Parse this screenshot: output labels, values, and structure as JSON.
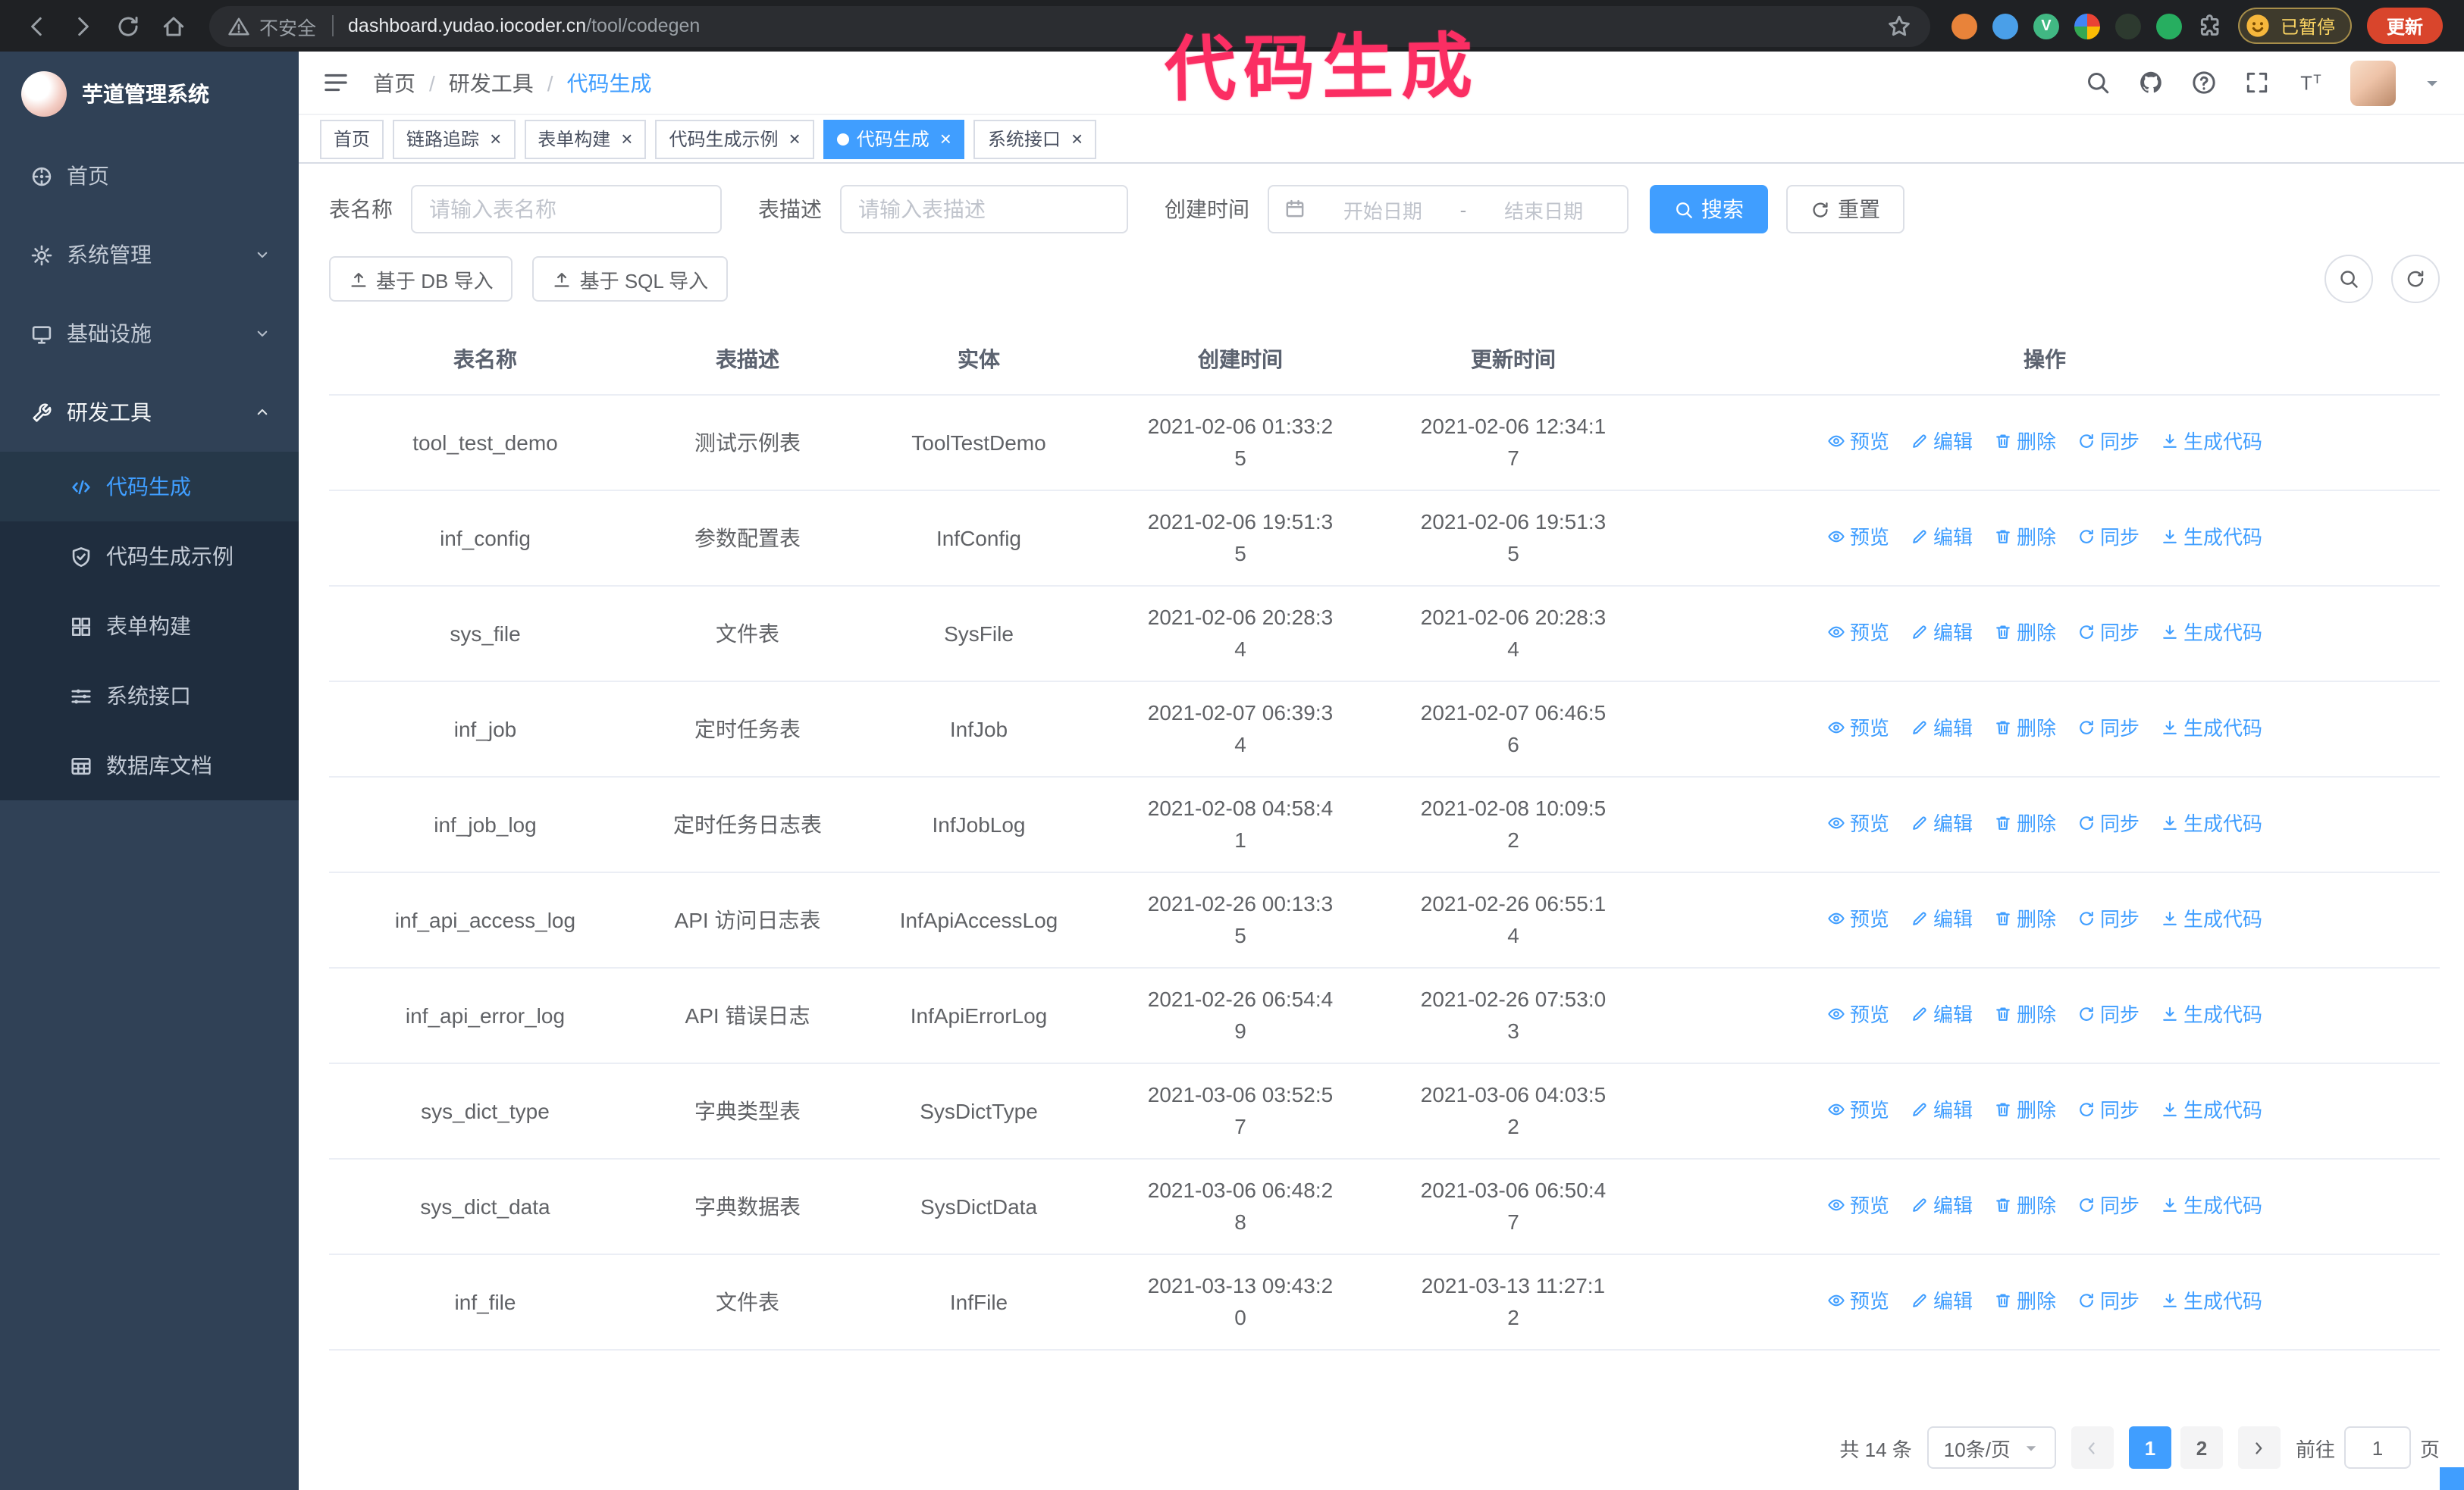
{
  "browser": {
    "security_label": "不安全",
    "url_host": "dashboard.yudao.iocoder.cn",
    "url_path": "/tool/codegen",
    "paused_badge": "已暂停",
    "update_button": "更新",
    "extensions": [
      {
        "color": "#e8833a",
        "label": ""
      },
      {
        "color": "#4a9fe8",
        "label": ""
      },
      {
        "color": "#41b883",
        "label": "V"
      },
      {
        "style": "multi",
        "label": ""
      },
      {
        "color": "#2d3a2f",
        "label": ""
      },
      {
        "color": "#27ae60",
        "label": ""
      },
      {
        "style": "puzzle",
        "label": ""
      }
    ]
  },
  "annotation": {
    "text": "代码生成",
    "color": "#fb2e63"
  },
  "sidebar": {
    "logo_title": "芋道管理系统",
    "items": [
      {
        "id": "home",
        "label": "首页",
        "icon": "dashboard-icon",
        "type": "root"
      },
      {
        "id": "system",
        "label": "系统管理",
        "icon": "gear-icon",
        "type": "root",
        "expandable": true,
        "expanded": false
      },
      {
        "id": "infra",
        "label": "基础设施",
        "icon": "infra-icon",
        "type": "root",
        "expandable": true,
        "expanded": false
      },
      {
        "id": "devtools",
        "label": "研发工具",
        "icon": "tools-icon",
        "type": "root",
        "expandable": true,
        "expanded": true
      },
      {
        "id": "codegen",
        "label": "代码生成",
        "icon": "code-icon",
        "type": "sub",
        "active": true
      },
      {
        "id": "codegen-example",
        "label": "代码生成示例",
        "icon": "shield-check-icon",
        "type": "sub"
      },
      {
        "id": "form-build",
        "label": "表单构建",
        "icon": "form-grid-icon",
        "type": "sub"
      },
      {
        "id": "system-api",
        "label": "系统接口",
        "icon": "sliders-icon",
        "type": "sub"
      },
      {
        "id": "db-doc",
        "label": "数据库文档",
        "icon": "table-doc-icon",
        "type": "sub"
      }
    ]
  },
  "navbar": {
    "breadcrumb": [
      "首页",
      "研发工具",
      "代码生成"
    ],
    "icons": [
      "search-icon",
      "github-icon",
      "help-icon",
      "fullscreen-icon",
      "font-size-icon"
    ]
  },
  "tabs": [
    {
      "id": "home",
      "label": "首页",
      "closable": false,
      "active": false
    },
    {
      "id": "tracer",
      "label": "链路追踪",
      "closable": true,
      "active": false
    },
    {
      "id": "form-build",
      "label": "表单构建",
      "closable": true,
      "active": false
    },
    {
      "id": "codegen-example",
      "label": "代码生成示例",
      "closable": true,
      "active": false
    },
    {
      "id": "codegen",
      "label": "代码生成",
      "closable": true,
      "active": true
    },
    {
      "id": "system-api",
      "label": "系统接口",
      "closable": true,
      "active": false
    }
  ],
  "filters": {
    "table_name_label": "表名称",
    "table_name_placeholder": "请输入表名称",
    "table_desc_label": "表描述",
    "table_desc_placeholder": "请输入表描述",
    "create_time_label": "创建时间",
    "date_start_placeholder": "开始日期",
    "date_separator": "-",
    "date_end_placeholder": "结束日期",
    "search_button": "搜索",
    "reset_button": "重置"
  },
  "toolbar": {
    "import_db_button": "基于 DB 导入",
    "import_sql_button": "基于 SQL 导入"
  },
  "table": {
    "columns": [
      "表名称",
      "表描述",
      "实体",
      "创建时间",
      "更新时间",
      "操作"
    ],
    "actions": [
      {
        "id": "preview",
        "label": "预览",
        "icon": "eye-icon"
      },
      {
        "id": "edit",
        "label": "编辑",
        "icon": "edit-icon"
      },
      {
        "id": "delete",
        "label": "删除",
        "icon": "delete-icon"
      },
      {
        "id": "sync",
        "label": "同步",
        "icon": "sync-icon"
      },
      {
        "id": "generate",
        "label": "生成代码",
        "icon": "download-icon"
      }
    ],
    "rows": [
      {
        "name": "tool_test_demo",
        "desc": "测试示例表",
        "entity": "ToolTestDemo",
        "created": "2021-02-06 01:33:25",
        "updated": "2021-02-06 12:34:17"
      },
      {
        "name": "inf_config",
        "desc": "参数配置表",
        "entity": "InfConfig",
        "created": "2021-02-06 19:51:35",
        "updated": "2021-02-06 19:51:35"
      },
      {
        "name": "sys_file",
        "desc": "文件表",
        "entity": "SysFile",
        "created": "2021-02-06 20:28:34",
        "updated": "2021-02-06 20:28:34"
      },
      {
        "name": "inf_job",
        "desc": "定时任务表",
        "entity": "InfJob",
        "created": "2021-02-07 06:39:34",
        "updated": "2021-02-07 06:46:56"
      },
      {
        "name": "inf_job_log",
        "desc": "定时任务日志表",
        "entity": "InfJobLog",
        "created": "2021-02-08 04:58:41",
        "updated": "2021-02-08 10:09:52"
      },
      {
        "name": "inf_api_access_log",
        "desc": "API 访问日志表",
        "entity": "InfApiAccessLog",
        "created": "2021-02-26 00:13:35",
        "updated": "2021-02-26 06:55:14"
      },
      {
        "name": "inf_api_error_log",
        "desc": "API 错误日志",
        "entity": "InfApiErrorLog",
        "created": "2021-02-26 06:54:49",
        "updated": "2021-02-26 07:53:03"
      },
      {
        "name": "sys_dict_type",
        "desc": "字典类型表",
        "entity": "SysDictType",
        "created": "2021-03-06 03:52:57",
        "updated": "2021-03-06 04:03:52"
      },
      {
        "name": "sys_dict_data",
        "desc": "字典数据表",
        "entity": "SysDictData",
        "created": "2021-03-06 06:48:28",
        "updated": "2021-03-06 06:50:47"
      },
      {
        "name": "inf_file",
        "desc": "文件表",
        "entity": "InfFile",
        "created": "2021-03-13 09:43:20",
        "updated": "2021-03-13 11:27:12"
      }
    ]
  },
  "pagination": {
    "total_text": "共 14 条",
    "page_size": "10条/页",
    "pages": [
      "1",
      "2"
    ],
    "current_page": "1",
    "goto_prefix": "前往",
    "goto_value": "1",
    "goto_suffix": "页"
  },
  "colors": {
    "primary": "#409eff",
    "sidebar_bg": "#304156",
    "submenu_bg": "#1f2d3e",
    "annotation": "#fb2e63",
    "update_button_bg": "#d9452c"
  }
}
